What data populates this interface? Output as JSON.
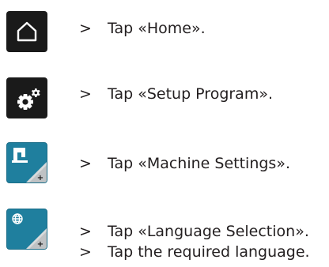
{
  "steps": [
    {
      "marker": ">",
      "text": "Tap «Home».",
      "icon": "home-icon"
    },
    {
      "marker": ">",
      "text": "Tap «Setup Program».",
      "icon": "gears-icon"
    },
    {
      "marker": ">",
      "text": "Tap «Machine Settings».",
      "icon": "sewing-machine-icon"
    },
    {
      "marker": ">",
      "text": "Tap «Language Selection».",
      "icon": "globe-icon"
    },
    {
      "marker": ">",
      "text": "Tap the required language."
    }
  ],
  "colors": {
    "dark_button": "#1a1a1a",
    "teal_button": "#1f7f9e",
    "text": "#231f20"
  }
}
